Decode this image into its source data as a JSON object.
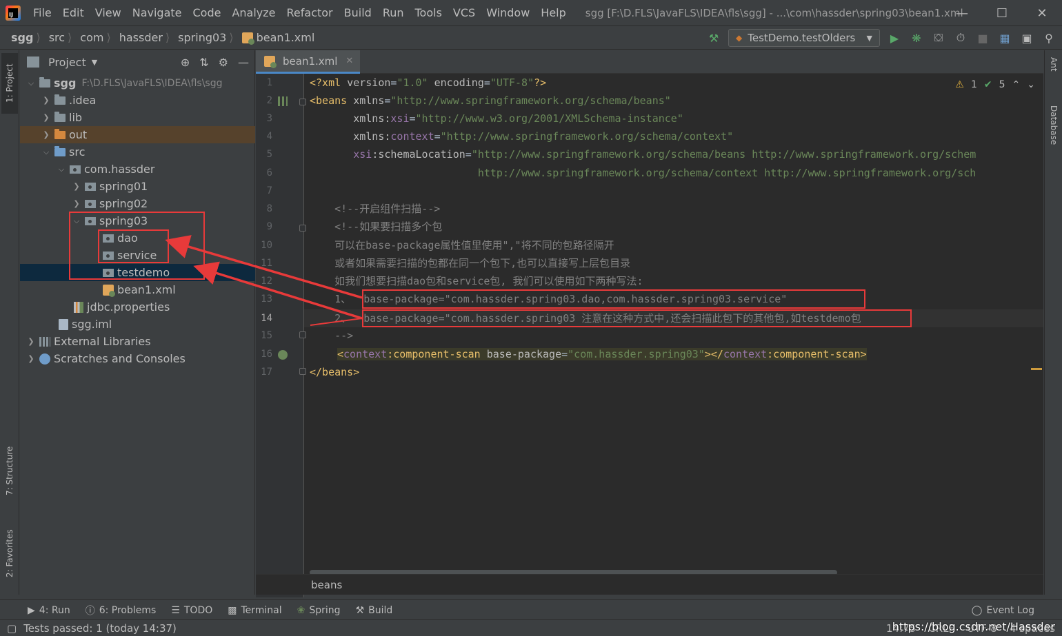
{
  "app": {
    "window_title": "sgg [F:\\D.FLS\\JavaFLS\\IDEA\\fls\\sgg] - ...\\com\\hassder\\spring03\\bean1.xml",
    "menu": [
      "File",
      "Edit",
      "View",
      "Navigate",
      "Code",
      "Analyze",
      "Refactor",
      "Build",
      "Run",
      "Tools",
      "VCS",
      "Window",
      "Help"
    ]
  },
  "nav": {
    "crumbs": [
      "sgg",
      "src",
      "com",
      "hassder",
      "spring03",
      "bean1.xml"
    ],
    "run_config": "TestDemo.testOlders"
  },
  "left_stripe": {
    "project": "1: Project",
    "structure": "7: Structure",
    "favorites": "2: Favorites"
  },
  "right_stripe": {
    "ant": "Ant",
    "database": "Database"
  },
  "project_panel": {
    "title": "Project",
    "tree": [
      {
        "label": "sgg",
        "extra": "F:\\D.FLS\\JavaFLS\\IDEA\\fls\\sgg"
      },
      {
        "label": ".idea"
      },
      {
        "label": "lib"
      },
      {
        "label": "out"
      },
      {
        "label": "src"
      },
      {
        "label": "com.hassder"
      },
      {
        "label": "spring01"
      },
      {
        "label": "spring02"
      },
      {
        "label": "spring03"
      },
      {
        "label": "dao"
      },
      {
        "label": "service"
      },
      {
        "label": "testdemo"
      },
      {
        "label": "bean1.xml"
      },
      {
        "label": "jdbc.properties"
      },
      {
        "label": "sgg.iml"
      },
      {
        "label": "External Libraries"
      },
      {
        "label": "Scratches and Consoles"
      }
    ]
  },
  "editor": {
    "tab": "bean1.xml",
    "inspections": {
      "warnings": "1",
      "ok": "5"
    },
    "line_numbers": [
      "1",
      "2",
      "3",
      "4",
      "5",
      "6",
      "7",
      "8",
      "9",
      "10",
      "11",
      "12",
      "13",
      "14",
      "15",
      "16",
      "17"
    ],
    "current_line": "14",
    "lines": {
      "l1_a": "<?xml",
      "l1_b": " version",
      "l1_c": "=",
      "l1_d": "\"1.0\"",
      "l1_e": " encoding",
      "l1_f": "=",
      "l1_g": "\"UTF-8\"",
      "l1_h": "?>",
      "l2_a": "<beans",
      "l2_b": " xmlns",
      "l2_c": "=",
      "l2_d": "\"http://www.springframework.org/schema/beans\"",
      "l3_a": "       xmlns:",
      "l3_b": "xsi",
      "l3_c": "=",
      "l3_d": "\"http://www.w3.org/2001/XMLSchema-instance\"",
      "l4_a": "       xmlns:",
      "l4_b": "context",
      "l4_c": "=",
      "l4_d": "\"http://www.springframework.org/schema/context\"",
      "l5_a": "       ",
      "l5_b": "xsi",
      "l5_c": ":schemaLocation",
      "l5_d": "=",
      "l5_e": "\"http://www.springframework.org/schema/beans http://www.springframework.org/schem",
      "l6": "                           http://www.springframework.org/schema/context http://www.springframework.org/sch",
      "l8": "    <!--开启组件扫描-->",
      "l9": "    <!--如果要扫描多个包",
      "l10": "    可以在base-package属性值里使用\",\"将不同的包路径隔开",
      "l11": "    或者如果需要扫描的包都在同一个包下,也可以直接写上层包目录",
      "l12": "    如我们想要扫描dao包和service包, 我们可以使用如下两种写法:",
      "l13": "    1、  base-package=\"com.hassder.spring03.dao,com.hassder.spring03.service\"",
      "l14": "    2、  base-package=\"com.hassder.spring03 注意在这种方式中,还会扫描此包下的其他包,如testdemo包",
      "l15": "    -->",
      "l16_a": "<",
      "l16_b": "context",
      "l16_c": ":component-scan",
      "l16_d": " base-package",
      "l16_e": "=",
      "l16_f": "\"com.hassder.spring03\"",
      "l16_g": "></",
      "l16_h": "context",
      "l16_i": ":component-scan>",
      "l17": "</beans>"
    },
    "bottom_breadcrumb": "beans"
  },
  "bottom_tools": {
    "run": "4: Run",
    "problems": "6: Problems",
    "todo": "TODO",
    "terminal": "Terminal",
    "spring": "Spring",
    "build": "Build",
    "event_log": "Event Log"
  },
  "status": {
    "message": "Tests passed: 1 (today 14:37)",
    "position": "14:75",
    "line_sep": "CRLF",
    "encoding": "UTF-8",
    "indent": "4 spaces",
    "watermark": "https://blog.csdn.net/Hassder"
  },
  "colors": {
    "annotation": "#e83a3a",
    "accent": "#4a88c7"
  }
}
